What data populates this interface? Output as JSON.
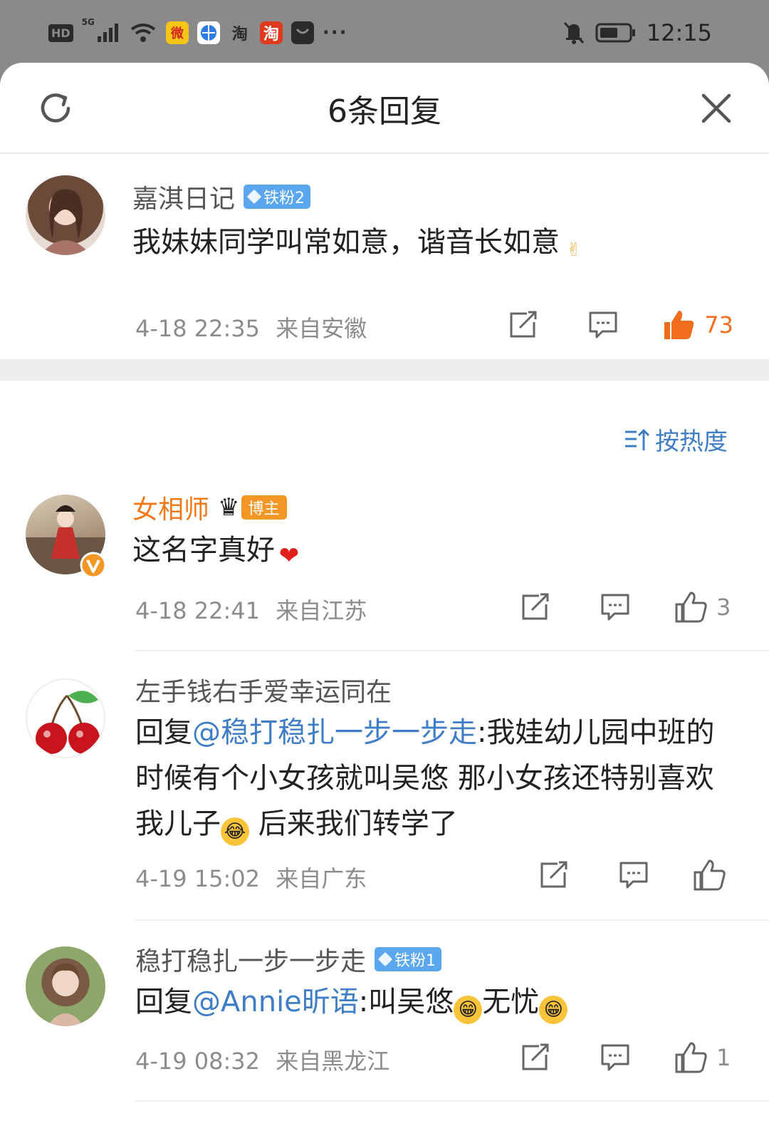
{
  "status_bar": {
    "hd": "HD",
    "signal": "5G",
    "app_icons": [
      "weibo-icon",
      "browser-icon",
      "taobao-outline-icon",
      "taobao-icon",
      "message-app-icon"
    ],
    "more": "···",
    "time": "12:15"
  },
  "header": {
    "title": "6条回复"
  },
  "main_comment": {
    "username": "嘉淇日记",
    "badge": "铁粉2",
    "text": "我妹妹同学叫常如意，谐音长如意",
    "emoji": "✌",
    "time": "4-18 22:35",
    "location": "来自安徽",
    "likes": "73"
  },
  "sort": {
    "label": "按热度"
  },
  "replies": [
    {
      "username": "女相师",
      "badge": "博主",
      "text": "这名字真好",
      "emoji": "❤",
      "time": "4-18 22:41",
      "location": "来自江苏",
      "likes": "3"
    },
    {
      "username": "左手钱右手爱幸运同在",
      "reply_prefix": "回复",
      "mention": "@稳打稳扎一步一步走",
      "text_part1": ":我娃幼儿园中班的时候有个小女孩就叫吴悠 那小女孩还特别喜欢我儿子",
      "text_part2": " 后来我们转学了",
      "time": "4-19 15:02",
      "location": "来自广东",
      "likes": ""
    },
    {
      "username": "稳打稳扎一步一步走",
      "badge": "铁粉1",
      "reply_prefix": "回复",
      "mention": "@Annie昕语",
      "text_part1": ":叫吴悠",
      "text_part2": "无忧",
      "time": "4-19 08:32",
      "location": "来自黑龙江",
      "likes": "1"
    }
  ],
  "colors": {
    "accent_blue": "#3f7ec6",
    "like_orange": "#f06d1d",
    "host_orange": "#f07a1b",
    "fan_badge": "#5aa7f0"
  }
}
